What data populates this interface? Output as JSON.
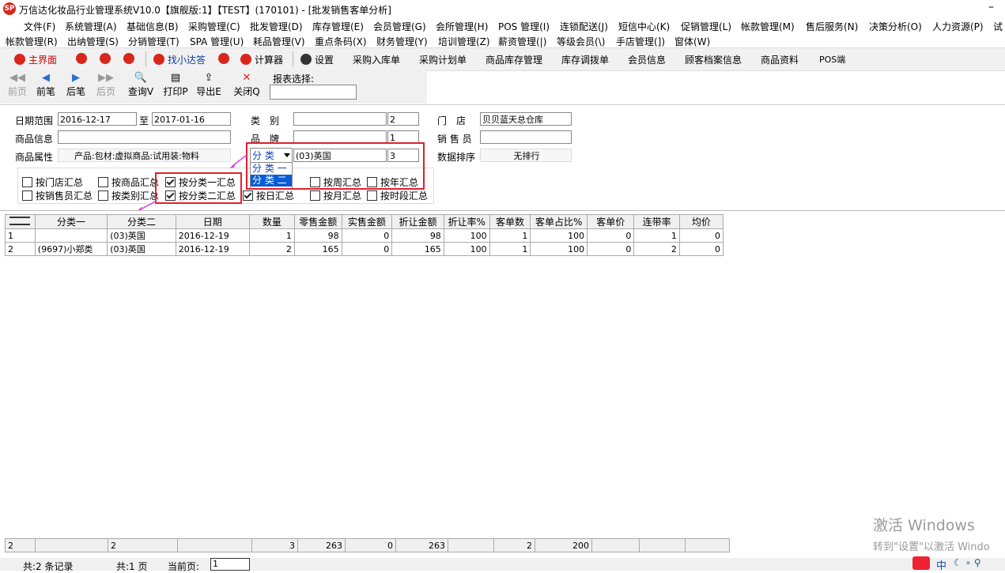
{
  "window": {
    "title": "万信达化妆品行业管理系统V10.0【旗舰版:1】【TEST】(170101) - [批发销售客单分析]",
    "logo": "SP",
    "minimize": "–"
  },
  "menu_row1": [
    "文件(F)",
    "系统管理(A)",
    "基础信息(B)",
    "采购管理(C)",
    "批发管理(D)",
    "库存管理(E)",
    "会员管理(G)",
    "会所管理(H)",
    "POS 管理(I)",
    "连锁配送(J)",
    "短信中心(K)",
    "促销管理(L)",
    "帐款管理(M)",
    "售后服务(N)",
    "决策分析(O)",
    "人力资源(P)",
    "试"
  ],
  "menu_row2": [
    "帐款管理(R)",
    "出纳管理(S)",
    "分销管理(T)",
    "SPA 管理(U)",
    "耗品管理(V)",
    "重点条码(X)",
    "财务管理(Y)",
    "培训管理(Z)",
    "薪资管理(|)",
    "等级会员(\\)",
    "手店管理(])",
    "窗体(W)"
  ],
  "quickbar": {
    "main": "主界面",
    "assistant": "找小达答",
    "calc": "计算器",
    "settings": "设置",
    "items": [
      "采购入库单",
      "采购计划单",
      "商品库存管理",
      "库存调拨单",
      "会员信息",
      "顾客档案信息",
      "商品资料",
      "POS端"
    ]
  },
  "toolbar": {
    "first": "前页",
    "prev": "前笔",
    "next": "后笔",
    "last": "后页",
    "query": "查询V",
    "print": "打印P",
    "export": "导出E",
    "close": "关闭Q",
    "report_select": "报表选择:"
  },
  "filters": {
    "date_label": "日期范围",
    "date_from": "2016-12-17",
    "date_to_label": "至",
    "date_to": "2017-01-16",
    "category_label": "类　别",
    "category_value": "",
    "category_count": "2",
    "store_label": "门　店",
    "store_value": "贝贝蓝天总仓库",
    "product_info_label": "商品信息",
    "brand_label": "品　牌",
    "brand_value": "",
    "brand_count": "1",
    "sales_label": "销 售 员",
    "sales_value": "",
    "attr_label": "商品属性",
    "attr_value": "产品:包材:虚拟商品:试用装:物料",
    "class_dropdown": "分 类",
    "class_value": "(03)英国",
    "class_count": "3",
    "sort_label": "数据排序",
    "sort_value": "无排行",
    "dropdown_options": [
      "分 类 一",
      "分 类 二"
    ]
  },
  "checkboxes_row1": [
    {
      "label": "按门店汇总",
      "checked": false
    },
    {
      "label": "按商品汇总",
      "checked": false
    },
    {
      "label": "按分类一汇总",
      "checked": true
    },
    {
      "label": "按周汇总",
      "checked": false
    },
    {
      "label": "按年汇总",
      "checked": false
    }
  ],
  "checkboxes_row2": [
    {
      "label": "按销售员汇总",
      "checked": false
    },
    {
      "label": "按类别汇总",
      "checked": false
    },
    {
      "label": "按分类二汇总",
      "checked": true
    },
    {
      "label": "按日汇总",
      "checked": true
    },
    {
      "label": "按月汇总",
      "checked": false
    },
    {
      "label": "按时段汇总",
      "checked": false
    }
  ],
  "table": {
    "columns": [
      "",
      "分类一",
      "分类二",
      "日期",
      "数量",
      "零售金额",
      "实售金额",
      "折让金额",
      "折让率%",
      "客单数",
      "客单占比%",
      "客单价",
      "连带率",
      "均价"
    ],
    "rows": [
      [
        "1",
        "",
        "(03)英国",
        "2016-12-19",
        "1",
        "98",
        "0",
        "98",
        "100",
        "1",
        "100",
        "0",
        "1",
        "0"
      ],
      [
        "2",
        "(9697)小郑类",
        "(03)英国",
        "2016-12-19",
        "2",
        "165",
        "0",
        "165",
        "100",
        "1",
        "100",
        "0",
        "2",
        "0"
      ]
    ],
    "footer": [
      "2",
      "",
      "2",
      "",
      "3",
      "263",
      "0",
      "263",
      "",
      "2",
      "200",
      "",
      "",
      ""
    ]
  },
  "status": {
    "records": "共:2 条记录",
    "pages": "共:1 页",
    "current_label": "当前页:",
    "current": "1"
  },
  "watermark": {
    "line1": "激活 Windows",
    "line2": "转到\"设置\"以激活 Windo"
  },
  "tray": {
    "ime": "中",
    "icons": "☾ ∘ ⚲"
  }
}
